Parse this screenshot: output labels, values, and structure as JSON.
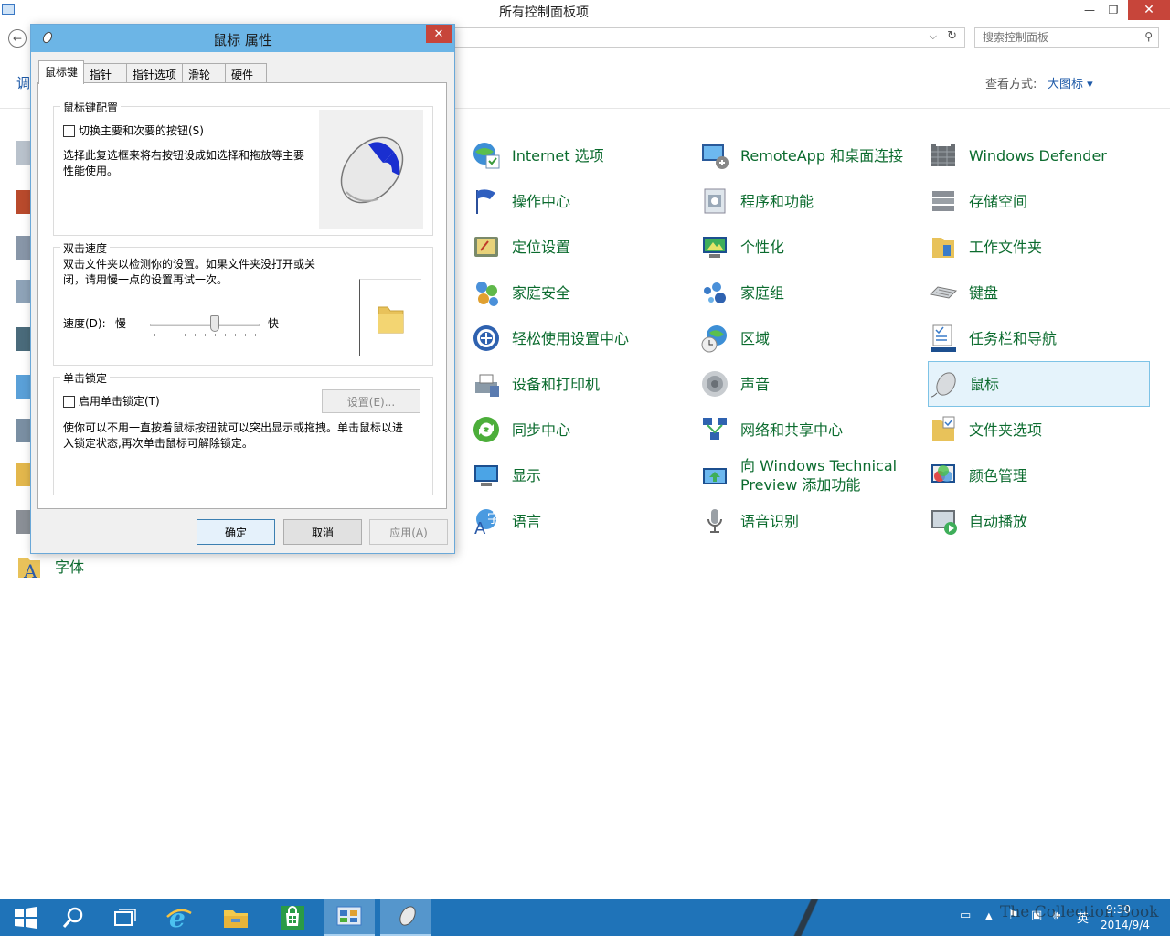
{
  "control_panel": {
    "title": "所有控制面板项",
    "search_placeholder": "搜索控制面板",
    "left_truncated_label": "调",
    "view_by_label": "查看方式:",
    "view_by_value": "大图标 ▾",
    "items": [
      {
        "label": "Internet 选项",
        "icon": "internet-options-icon"
      },
      {
        "label": "RemoteApp 和桌面连接",
        "icon": "remoteapp-icon"
      },
      {
        "label": "Windows Defender",
        "icon": "windows-defender-icon"
      },
      {
        "label": "操作中心",
        "icon": "action-center-flag-icon"
      },
      {
        "label": "程序和功能",
        "icon": "programs-features-icon"
      },
      {
        "label": "存储空间",
        "icon": "storage-spaces-icon"
      },
      {
        "label": "定位设置",
        "icon": "location-settings-icon"
      },
      {
        "label": "个性化",
        "icon": "personalization-icon"
      },
      {
        "label": "工作文件夹",
        "icon": "work-folders-icon"
      },
      {
        "label": "家庭安全",
        "icon": "family-safety-icon"
      },
      {
        "label": "家庭组",
        "icon": "homegroup-icon"
      },
      {
        "label": "键盘",
        "icon": "keyboard-icon"
      },
      {
        "label": "轻松使用设置中心",
        "icon": "ease-of-access-icon"
      },
      {
        "label": "区域",
        "icon": "region-icon"
      },
      {
        "label": "任务栏和导航",
        "icon": "taskbar-navigation-icon"
      },
      {
        "label": "设备和打印机",
        "icon": "devices-printers-icon"
      },
      {
        "label": "声音",
        "icon": "sound-icon"
      },
      {
        "label": "鼠标",
        "icon": "mouse-icon"
      },
      {
        "label": "同步中心",
        "icon": "sync-center-icon"
      },
      {
        "label": "网络和共享中心",
        "icon": "network-sharing-icon"
      },
      {
        "label": "文件夹选项",
        "icon": "folder-options-icon"
      },
      {
        "label": "显示",
        "icon": "display-icon"
      },
      {
        "label": "向 Windows Technical Preview 添加功能",
        "icon": "add-features-icon"
      },
      {
        "label": "颜色管理",
        "icon": "color-management-icon"
      },
      {
        "label": "语言",
        "icon": "language-icon"
      },
      {
        "label": "语音识别",
        "icon": "speech-recognition-icon"
      },
      {
        "label": "自动播放",
        "icon": "autoplay-icon"
      },
      {
        "label": "字体",
        "icon": "fonts-icon"
      }
    ]
  },
  "dialog": {
    "title": "鼠标 属性",
    "close_glyph": "✕",
    "tabs": [
      "鼠标键",
      "指针",
      "指针选项",
      "滑轮",
      "硬件"
    ],
    "button_config": {
      "group_title": "鼠标键配置",
      "switch_label": "切换主要和次要的按钮(S)",
      "description": "选择此复选框来将右按钮设成如选择和拖放等主要性能使用。",
      "switch_checked": false
    },
    "double_click": {
      "group_title": "双击速度",
      "description": "双击文件夹以检测你的设置。如果文件夹没打开或关闭，请用慢一点的设置再试一次。",
      "speed_label": "速度(D):",
      "slow_label": "慢",
      "fast_label": "快",
      "speed_value": 0.6
    },
    "click_lock": {
      "group_title": "单击锁定",
      "enable_label": "启用单击锁定(T)",
      "settings_button": "设置(E)...",
      "description": "使你可以不用一直按着鼠标按钮就可以突出显示或拖拽。单击鼠标以进入锁定状态,再次单击鼠标可解除锁定。",
      "enabled": false
    },
    "buttons": {
      "ok": "确定",
      "cancel": "取消",
      "apply": "应用(A)"
    }
  },
  "taskbar": {
    "time": "9:30",
    "date": "2014/9/4",
    "ime": "英",
    "watermark": "The Collection Book"
  }
}
